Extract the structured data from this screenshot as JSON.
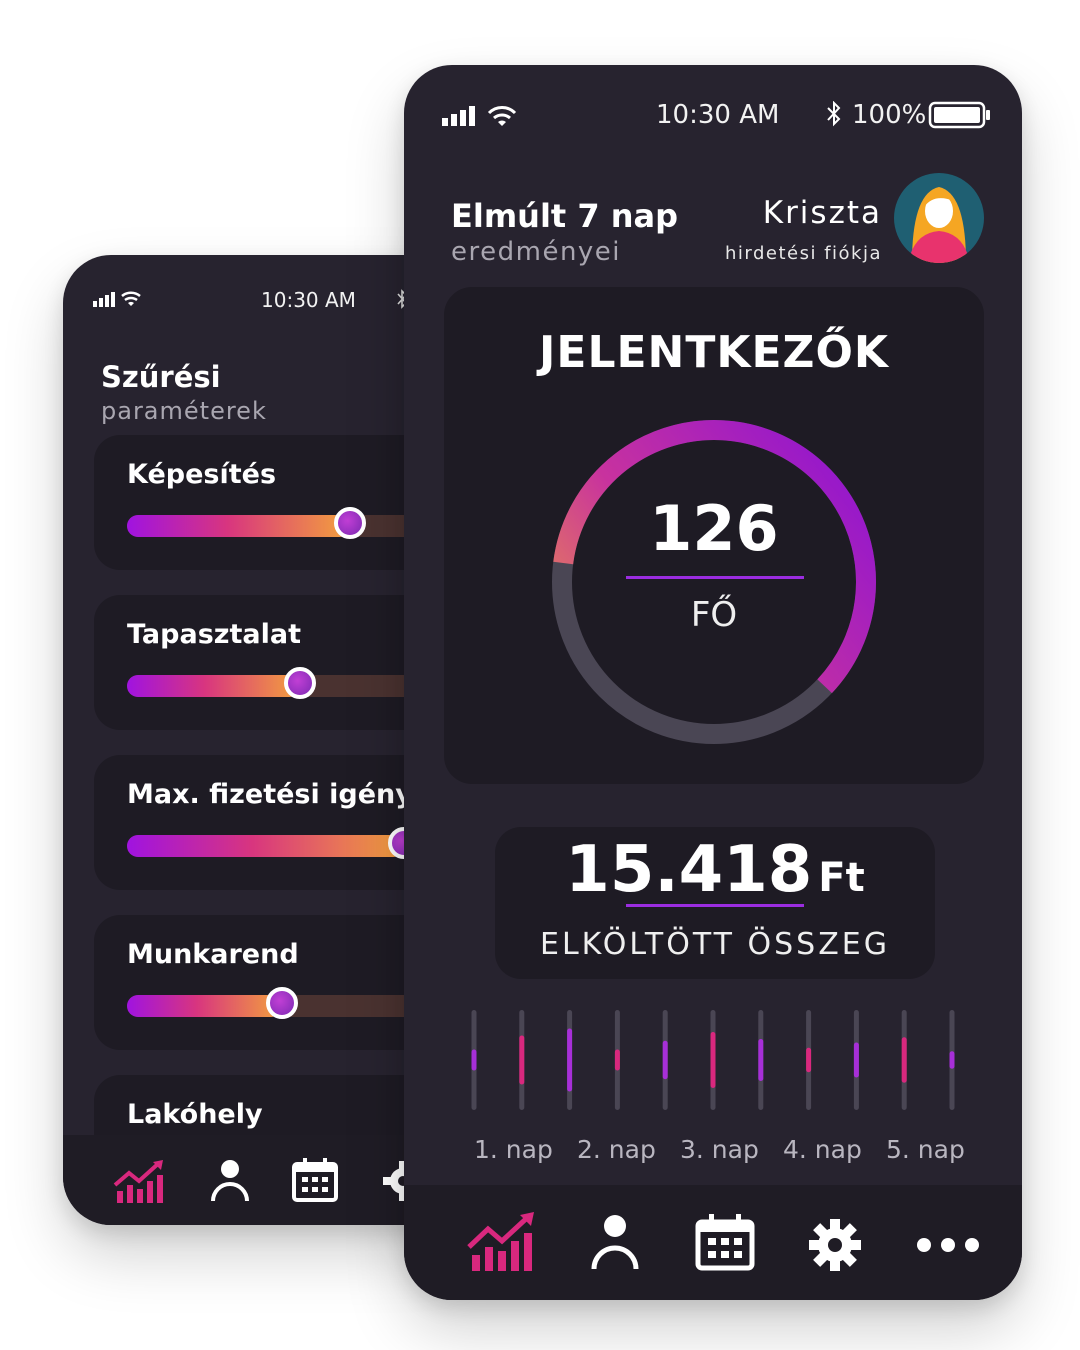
{
  "back": {
    "time": "10:30 AM",
    "title": "Szűrési",
    "subtitle": "paraméterek",
    "filters": [
      {
        "label": "Képesítés",
        "value": 0.62
      },
      {
        "label": "Tapasztalat",
        "value": 0.48
      },
      {
        "label": "Max. fizetési igény",
        "value": 0.77
      },
      {
        "label": "Munkarend",
        "value": 0.43
      },
      {
        "label": "Lakóhely"
      }
    ],
    "nav": [
      "chart-icon",
      "user-icon",
      "calendar-icon",
      "gear-icon"
    ]
  },
  "front": {
    "time": "10:30 AM",
    "battery": "100%",
    "title": "Elmúlt 7 nap",
    "subtitle": "eredményei",
    "user_name": "Kriszta",
    "account_label": "hirdetési fiókja",
    "applicants": {
      "heading": "JELENTKEZŐK",
      "count": "126",
      "unit": "FŐ",
      "progress": 0.6
    },
    "spent": {
      "amount": "15.418",
      "currency": "Ft",
      "label": "ELKÖLTÖTT ÖSSZEG"
    },
    "days": [
      "1. nap",
      "2. nap",
      "3. nap",
      "4. nap",
      "5. nap"
    ],
    "daily_bars": [
      0.3,
      0.7,
      0.9,
      0.3,
      0.55,
      0.8,
      0.6,
      0.35,
      0.5,
      0.65,
      0.25
    ],
    "nav": [
      "chart-icon",
      "user-icon",
      "calendar-icon",
      "gear-icon",
      "more-icon"
    ],
    "colors": {
      "accent": "#d9287e",
      "purple": "#9b2de0",
      "orange": "#f3a23c"
    }
  }
}
